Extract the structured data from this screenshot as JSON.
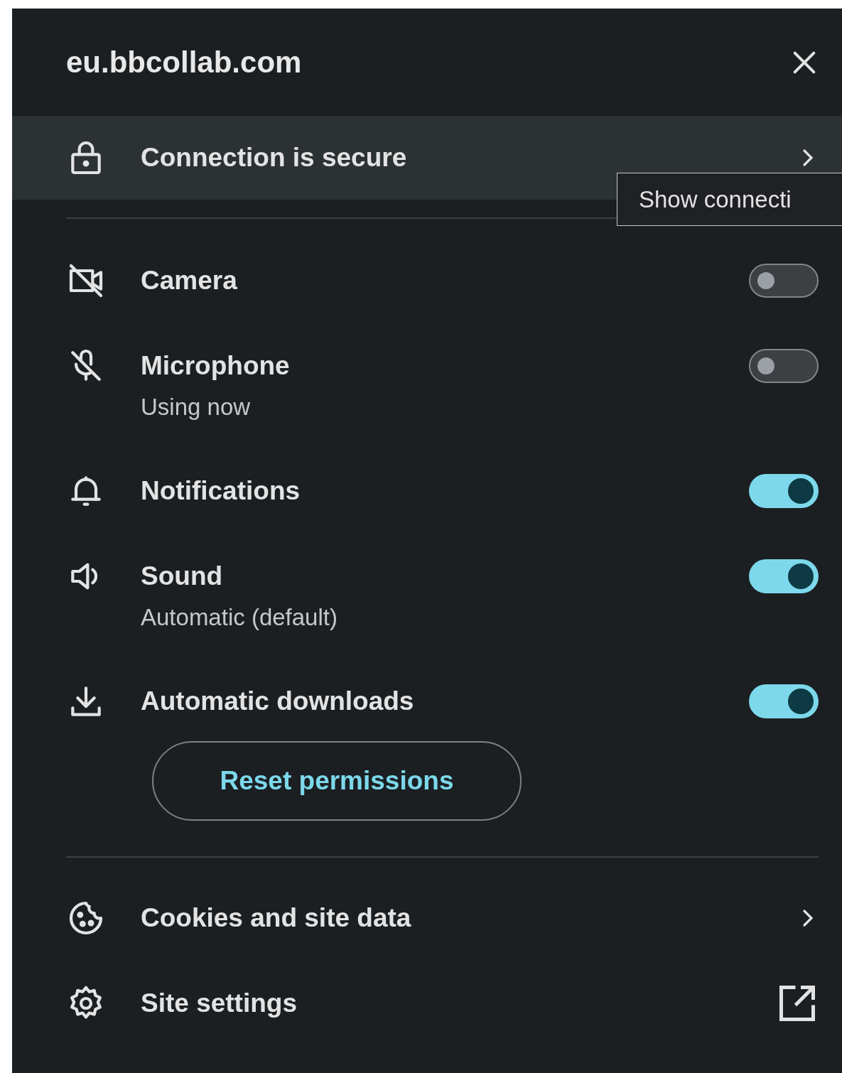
{
  "site": {
    "title": "eu.bbcollab.com"
  },
  "connection": {
    "label": "Connection is secure",
    "tooltip": "Show connecti"
  },
  "permissions": [
    {
      "kind": "camera",
      "label": "Camera",
      "on": false
    },
    {
      "kind": "microphone",
      "label": "Microphone",
      "detail": "Using now",
      "on": false
    },
    {
      "kind": "notifications",
      "label": "Notifications",
      "on": true
    },
    {
      "kind": "sound",
      "label": "Sound",
      "detail": "Automatic (default)",
      "on": true
    },
    {
      "kind": "downloads",
      "label": "Automatic downloads",
      "on": true
    }
  ],
  "reset_button": "Reset permissions",
  "links": [
    {
      "kind": "cookies",
      "label": "Cookies and site data",
      "trailing": {
        "kind": "chevron"
      }
    },
    {
      "kind": "settings",
      "label": "Site settings",
      "trailing": {
        "kind": "external"
      }
    }
  ]
}
